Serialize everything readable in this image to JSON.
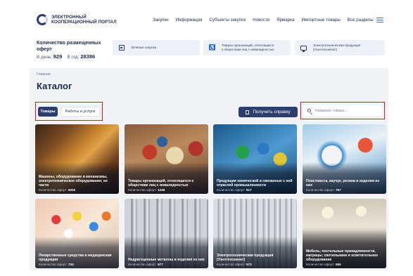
{
  "header": {
    "logo_line1": "ЭЛЕКТРОННЫЙ",
    "logo_line2": "КООПЕРАЦИОННЫЙ ПОРТАЛ",
    "nav": [
      "Закупки",
      "Информация",
      "Субъекты закупок",
      "Новости",
      "Ярмарка",
      "Импортные товары"
    ],
    "all_sections": "Все разделы",
    "accent": "#2f6fe0"
  },
  "stats": {
    "title_line1": "Количество размещенных",
    "title_line2": "оферт",
    "per_day_label": "В день:",
    "per_day_value": "929",
    "per_year_label": "В год:",
    "per_year_value": "28386",
    "cards": [
      {
        "icon": "green-procurement-icon",
        "lines": [
          "Зелёные закупки"
        ]
      },
      {
        "icon": "accessibility-icon",
        "lines": [
          "Товары организаций, относящихся",
          "к обществам лиц с инвалидностью"
        ]
      },
      {
        "icon": "electronics-icon",
        "lines": [
          "Электротехническая продукция",
          "(Узелтехсаноат)"
        ]
      }
    ]
  },
  "main": {
    "breadcrumb": "Главная",
    "title": "Каталог",
    "tabs": [
      {
        "label": "Товары",
        "active": true
      },
      {
        "label": "Работы и услуги",
        "active": false
      }
    ],
    "help_button": "Получить справку",
    "search_placeholder": "Название товара...",
    "search_value": "",
    "count_label": "Количество оферт:"
  },
  "catalog": [
    {
      "name": "Машины, оборудование и механизмы, электротехническое оборудование; их части",
      "count": "8292"
    },
    {
      "name": "Товары организаций, относящихся к обществам лиц с инвалидностью",
      "count": "1248"
    },
    {
      "name": "Продукция химической и связанных с ней отраслей промышленности",
      "count": "917"
    },
    {
      "name": "Пластмасса, каучук, резина и изделия из них",
      "count": "757"
    },
    {
      "name": "Лекарственные средства и медицинская продукция",
      "count": "734"
    },
    {
      "name": "Недрагоценные металлы и изделия из них",
      "count": "577"
    },
    {
      "name": "Электротехническая продукция (Узелтехсаноат)",
      "count": "573"
    },
    {
      "name": "Мебель; постельные принадлежности, матрацы; светильники и осветительное оборудование",
      "count": "555"
    }
  ],
  "colors": {
    "primary": "#2c3e6b",
    "highlight_frame": "#e0141e",
    "panel_bg": "#f1f3f7"
  }
}
